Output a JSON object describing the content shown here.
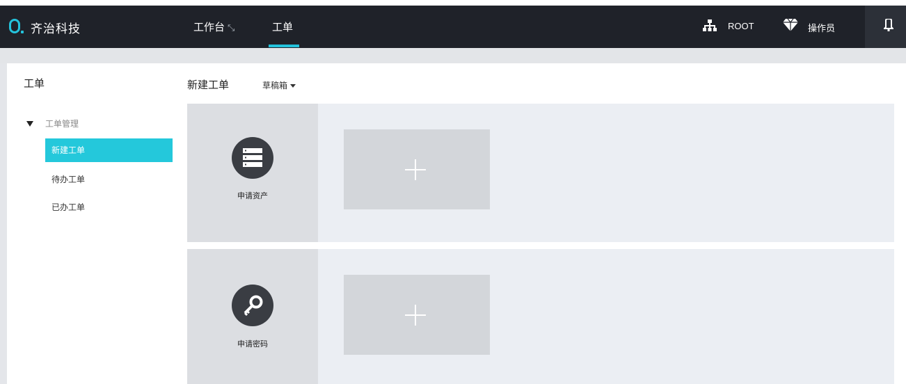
{
  "header": {
    "brand": "齐治科技",
    "nav": [
      {
        "label": "工作台",
        "suffix": "⤡"
      },
      {
        "label": "工单"
      }
    ],
    "user_org": "ROOT",
    "user_role": "操作员"
  },
  "sidebar": {
    "title": "工单",
    "group": "工单管理",
    "items": [
      {
        "label": "新建工单"
      },
      {
        "label": "待办工单"
      },
      {
        "label": "已办工单"
      }
    ]
  },
  "main": {
    "title": "新建工单",
    "drafts": "草稿箱",
    "cards": [
      {
        "label": "申请资产",
        "icon": "server-icon"
      },
      {
        "label": "申请密码",
        "icon": "key-icon"
      }
    ]
  },
  "colors": {
    "accent": "#24c8db",
    "topbar": "#1f2229"
  }
}
